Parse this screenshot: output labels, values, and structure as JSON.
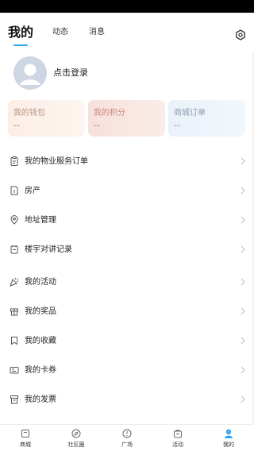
{
  "top_tabs": [
    {
      "label": "我的"
    },
    {
      "label": "动态"
    },
    {
      "label": "消息"
    }
  ],
  "settings_icon": "settings-icon",
  "profile": {
    "login_label": "点击登录",
    "avatar_icon": "avatar-placeholder-icon"
  },
  "cards": [
    {
      "title": "我的钱包",
      "value": "--"
    },
    {
      "title": "我的积分",
      "value": "--"
    },
    {
      "title": "商城订单",
      "value": "--"
    }
  ],
  "menu": [
    {
      "label": "我的物业服务订单",
      "icon": "clipboard-icon"
    },
    {
      "label": "房产",
      "icon": "house-doc-icon"
    },
    {
      "label": "地址管理",
      "icon": "location-pin-icon"
    },
    {
      "label": "楼宇对讲记录",
      "icon": "intercom-icon"
    },
    {
      "label": "我的活动",
      "icon": "party-popper-icon"
    },
    {
      "label": "我的奖品",
      "icon": "gift-box-icon"
    },
    {
      "label": "我的收藏",
      "icon": "bookmark-icon"
    },
    {
      "label": "我的卡券",
      "icon": "coupon-icon"
    },
    {
      "label": "我的发票",
      "icon": "invoice-icon"
    }
  ],
  "bottom_nav": [
    {
      "label": "商城",
      "icon": "shop-icon"
    },
    {
      "label": "社区圈",
      "icon": "compass-icon"
    },
    {
      "label": "广场",
      "icon": "square-info-icon"
    },
    {
      "label": "活动",
      "icon": "activity-bag-icon"
    },
    {
      "label": "我的",
      "icon": "user-icon",
      "active": true
    }
  ],
  "colors": {
    "accent": "#2aa5f0",
    "chevron": "#c4c4c4",
    "icon_stroke": "#555555"
  }
}
